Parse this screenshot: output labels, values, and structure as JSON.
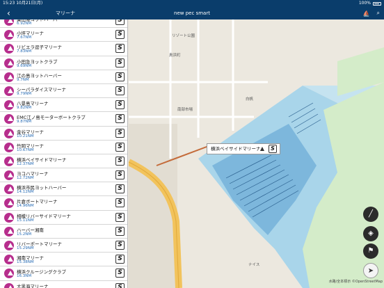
{
  "status": {
    "time": "15:23",
    "date": "10月21日(月)",
    "battery": "100%"
  },
  "nav": {
    "back": "‹",
    "section": "マリーナ",
    "title": "new pec smart"
  },
  "marinas": [
    {
      "name": "葉山港ヨットハーバー",
      "dist": "6.92NM"
    },
    {
      "name": "小坪マリーナ",
      "dist": "7.67NM"
    },
    {
      "name": "リビエラ逗子マリーナ",
      "dist": "7.83NM"
    },
    {
      "name": "小田急ヨットクラブ",
      "dist": "9.69NM"
    },
    {
      "name": "江の島ヨットハーバー",
      "dist": "9.7NM"
    },
    {
      "name": "シーパラダイスマリーナ",
      "dist": "9.79NM"
    },
    {
      "name": "八景島マリーナ",
      "dist": "9.82NM"
    },
    {
      "name": "EMC江ノ島モーターボートクラブ",
      "dist": "9.87NM"
    },
    {
      "name": "金谷マリーナ",
      "dist": "10.21NM"
    },
    {
      "name": "竹岡マリーナ",
      "dist": "10.67NM"
    },
    {
      "name": "横浜ベイサイドマリーナ",
      "dist": "12.37NM"
    },
    {
      "name": "ヨコハマリーナ",
      "dist": "12.72NM"
    },
    {
      "name": "横浜市民ヨットハーバー",
      "dist": "14.12NM"
    },
    {
      "name": "片倉ボートマリーナ",
      "dist": "14.96NM"
    },
    {
      "name": "相模リバーサイドマリーナ",
      "dist": "15.11NM"
    },
    {
      "name": "ハーバー湘南",
      "dist": "15.2NM"
    },
    {
      "name": "リバーポートマリーナ",
      "dist": "15.29NM"
    },
    {
      "name": "湘南マリーナ",
      "dist": "15.38NM"
    },
    {
      "name": "横浜クルージングクラブ",
      "dist": "16.3NM"
    },
    {
      "name": "大黒海マリーナ",
      "dist": ""
    }
  ],
  "map": {
    "callout": "横浜ベイサイドマリーナ",
    "labels": {
      "park": "リゾート公園",
      "torihama": "鳥浜町",
      "shirasagi": "白帆",
      "nanbu": "南部市場",
      "naisu": "ナイス",
      "credit": "水路/全本標示 ©OpenStreetMap"
    }
  },
  "colors": {
    "nav": "#0a3d6b",
    "marina": "#b72e8d",
    "water": "#a9d5ea",
    "dock": "#5b96c2"
  }
}
